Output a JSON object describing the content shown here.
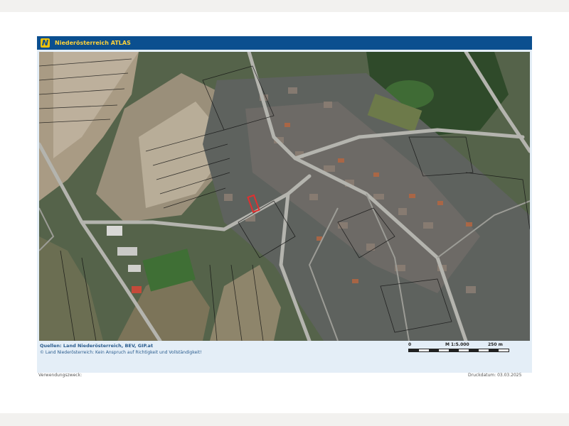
{
  "header": {
    "logo_letter": "N",
    "title": "Niederösterreich ATLAS"
  },
  "map": {
    "sources_text": "Quellen: Land Niederösterreich, BEV, GIP.at",
    "copyright_text": "© Land Niederösterreich: Kein Anspruch auf Richtigkeit und Vollständigkeit!",
    "scale": {
      "start_label": "0",
      "ratio_label": "M 1:5.000",
      "end_label": "250 m"
    }
  },
  "footer": {
    "purpose_label": "Verwendungszweck:",
    "print_date": "Druckdatum: 03.03.2025"
  },
  "colors": {
    "header": "#0b4f8f",
    "title": "#ffd23a",
    "highlight_parcel": "#e03030"
  }
}
